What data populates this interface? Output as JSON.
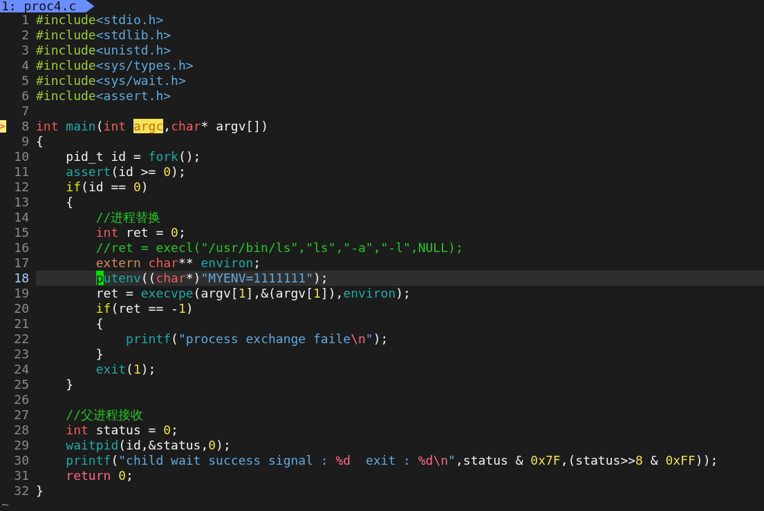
{
  "tab": {
    "label": "1: proc4.c"
  },
  "lines": [
    {
      "number": "1",
      "current": false,
      "tokens": [
        {
          "text": "#include",
          "kind": "preproc"
        },
        {
          "text": "<stdio.h>",
          "kind": "path"
        }
      ]
    },
    {
      "number": "2",
      "current": false,
      "tokens": [
        {
          "text": "#include",
          "kind": "preproc"
        },
        {
          "text": "<stdlib.h>",
          "kind": "path"
        }
      ]
    },
    {
      "number": "3",
      "current": false,
      "tokens": [
        {
          "text": "#include",
          "kind": "preproc"
        },
        {
          "text": "<unistd.h>",
          "kind": "path"
        }
      ]
    },
    {
      "number": "4",
      "current": false,
      "tokens": [
        {
          "text": "#include",
          "kind": "preproc"
        },
        {
          "text": "<sys/types.h>",
          "kind": "path"
        }
      ]
    },
    {
      "number": "5",
      "current": false,
      "tokens": [
        {
          "text": "#include",
          "kind": "preproc"
        },
        {
          "text": "<sys/wait.h>",
          "kind": "path"
        }
      ]
    },
    {
      "number": "6",
      "current": false,
      "tokens": [
        {
          "text": "#include",
          "kind": "preproc"
        },
        {
          "text": "<assert.h>",
          "kind": "path"
        }
      ]
    },
    {
      "number": "7",
      "current": false
    },
    {
      "number": "8",
      "current": false,
      "sign": ">",
      "tokens": [
        {
          "text": "int",
          "kind": "type"
        },
        {
          "text": " main",
          "kind": "func"
        },
        {
          "text": "(",
          "kind": "plain"
        },
        {
          "text": "int",
          "kind": "type"
        },
        {
          "text": " argc",
          "kind": "match"
        },
        {
          "text": ",",
          "kind": "plain"
        },
        {
          "text": "char",
          "kind": "type"
        },
        {
          "text": "* argv[])",
          "kind": "plain"
        }
      ]
    },
    {
      "number": "9",
      "current": false,
      "tokens": [
        {
          "text": "{",
          "kind": "plain"
        }
      ]
    },
    {
      "number": "10",
      "current": false,
      "tokens": [
        {
          "text": "    pid_t id = ",
          "kind": "plain"
        },
        {
          "text": "fork",
          "kind": "func"
        },
        {
          "text": "();",
          "kind": "plain"
        }
      ]
    },
    {
      "number": "11",
      "current": false,
      "tokens": [
        {
          "text": "    assert",
          "kind": "func"
        },
        {
          "text": "(id >= ",
          "kind": "plain"
        },
        {
          "text": "0",
          "kind": "num"
        },
        {
          "text": ");",
          "kind": "plain"
        }
      ]
    },
    {
      "number": "12",
      "current": false,
      "tokens": [
        {
          "text": "    if",
          "kind": "cond"
        },
        {
          "text": "(id == ",
          "kind": "plain"
        },
        {
          "text": "0",
          "kind": "num"
        },
        {
          "text": ")",
          "kind": "plain"
        }
      ]
    },
    {
      "number": "13",
      "current": false,
      "tokens": [
        {
          "text": "    {",
          "kind": "plain"
        }
      ]
    },
    {
      "number": "14",
      "current": false,
      "tokens": [
        {
          "text": "        //进程替换",
          "kind": "comment"
        }
      ]
    },
    {
      "number": "15",
      "current": false,
      "tokens": [
        {
          "text": "        int",
          "kind": "type"
        },
        {
          "text": " ret = ",
          "kind": "plain"
        },
        {
          "text": "0",
          "kind": "num"
        },
        {
          "text": ";",
          "kind": "plain"
        }
      ]
    },
    {
      "number": "16",
      "current": false,
      "tokens": [
        {
          "text": "        //ret = execl(\"/usr/bin/ls\",\"ls\",\"-a\",\"-l\",NULL);",
          "kind": "comment"
        }
      ]
    },
    {
      "number": "17",
      "current": false,
      "tokens": [
        {
          "text": "        extern",
          "kind": "storage"
        },
        {
          "text": " char",
          "kind": "type"
        },
        {
          "text": "** ",
          "kind": "plain"
        },
        {
          "text": "environ",
          "kind": "func"
        },
        {
          "text": ";",
          "kind": "plain"
        }
      ]
    },
    {
      "number": "18",
      "current": true,
      "tokens": [
        {
          "text": "        p",
          "kind": "cursor"
        },
        {
          "text": "utenv",
          "kind": "func"
        },
        {
          "text": "((",
          "kind": "plain"
        },
        {
          "text": "char",
          "kind": "type"
        },
        {
          "text": "*)",
          "kind": "plain"
        },
        {
          "text": "\"MYENV=1111111\"",
          "kind": "string"
        },
        {
          "text": ");",
          "kind": "plain"
        }
      ]
    },
    {
      "number": "19",
      "current": false,
      "tokens": [
        {
          "text": "        ret = ",
          "kind": "plain"
        },
        {
          "text": "execvpe",
          "kind": "func"
        },
        {
          "text": "(argv[",
          "kind": "plain"
        },
        {
          "text": "1",
          "kind": "num"
        },
        {
          "text": "],&(argv[",
          "kind": "plain"
        },
        {
          "text": "1",
          "kind": "num"
        },
        {
          "text": "]),",
          "kind": "plain"
        },
        {
          "text": "environ",
          "kind": "func"
        },
        {
          "text": ");",
          "kind": "plain"
        }
      ]
    },
    {
      "number": "20",
      "current": false,
      "tokens": [
        {
          "text": "        if",
          "kind": "cond"
        },
        {
          "text": "(ret == -",
          "kind": "plain"
        },
        {
          "text": "1",
          "kind": "num"
        },
        {
          "text": ")",
          "kind": "plain"
        }
      ]
    },
    {
      "number": "21",
      "current": false,
      "tokens": [
        {
          "text": "        {",
          "kind": "plain"
        }
      ]
    },
    {
      "number": "22",
      "current": false,
      "tokens": [
        {
          "text": "            printf",
          "kind": "func"
        },
        {
          "text": "(",
          "kind": "plain"
        },
        {
          "text": "\"process exchange faile",
          "kind": "string"
        },
        {
          "text": "\\n",
          "kind": "special"
        },
        {
          "text": "\"",
          "kind": "string"
        },
        {
          "text": ");",
          "kind": "plain"
        }
      ]
    },
    {
      "number": "23",
      "current": false,
      "tokens": [
        {
          "text": "        }",
          "kind": "plain"
        }
      ]
    },
    {
      "number": "24",
      "current": false,
      "tokens": [
        {
          "text": "        exit",
          "kind": "func"
        },
        {
          "text": "(",
          "kind": "plain"
        },
        {
          "text": "1",
          "kind": "num"
        },
        {
          "text": ");",
          "kind": "plain"
        }
      ]
    },
    {
      "number": "25",
      "current": false,
      "tokens": [
        {
          "text": "    }",
          "kind": "plain"
        }
      ]
    },
    {
      "number": "26",
      "current": false
    },
    {
      "number": "27",
      "current": false,
      "tokens": [
        {
          "text": "    //父进程接收",
          "kind": "comment"
        }
      ]
    },
    {
      "number": "28",
      "current": false,
      "tokens": [
        {
          "text": "    int",
          "kind": "type"
        },
        {
          "text": " status = ",
          "kind": "plain"
        },
        {
          "text": "0",
          "kind": "num"
        },
        {
          "text": ";",
          "kind": "plain"
        }
      ]
    },
    {
      "number": "29",
      "current": false,
      "tokens": [
        {
          "text": "    waitpid",
          "kind": "func"
        },
        {
          "text": "(id,&status,",
          "kind": "plain"
        },
        {
          "text": "0",
          "kind": "num"
        },
        {
          "text": ");",
          "kind": "plain"
        }
      ]
    },
    {
      "number": "30",
      "current": false,
      "tokens": [
        {
          "text": "    printf",
          "kind": "func"
        },
        {
          "text": "(",
          "kind": "plain"
        },
        {
          "text": "\"child wait success signal : ",
          "kind": "string"
        },
        {
          "text": "%d",
          "kind": "special"
        },
        {
          "text": "  exit : ",
          "kind": "string"
        },
        {
          "text": "%d\\n",
          "kind": "special"
        },
        {
          "text": "\"",
          "kind": "string"
        },
        {
          "text": ",status & ",
          "kind": "plain"
        },
        {
          "text": "0x7F",
          "kind": "num"
        },
        {
          "text": ",(status>>",
          "kind": "plain"
        },
        {
          "text": "8",
          "kind": "num"
        },
        {
          "text": " & ",
          "kind": "plain"
        },
        {
          "text": "0xFF",
          "kind": "num"
        },
        {
          "text": "));",
          "kind": "plain"
        }
      ]
    },
    {
      "number": "31",
      "current": false,
      "tokens": [
        {
          "text": "    return",
          "kind": "ret"
        },
        {
          "text": " 0",
          "kind": "num"
        },
        {
          "text": ";",
          "kind": "plain"
        }
      ]
    },
    {
      "number": "32",
      "current": false,
      "tokens": [
        {
          "text": "}",
          "kind": "plain"
        }
      ]
    }
  ],
  "filler": [
    "~"
  ]
}
